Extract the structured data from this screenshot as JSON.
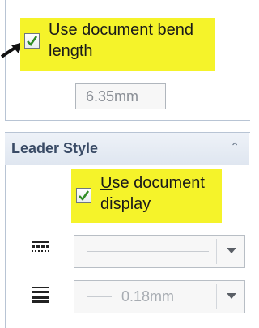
{
  "top_panel": {
    "bend_checkbox_label": "Use document bend length",
    "bend_checkbox_checked": true,
    "bend_length_value": "6.35mm"
  },
  "leader_style": {
    "title": "Leader Style",
    "display_checkbox_label_underlined": "U",
    "display_checkbox_label_rest": "se document display",
    "display_checkbox_checked": true,
    "line_style_value": "",
    "line_thickness_value": "0.18mm"
  },
  "colors": {
    "highlight": "#f5f32a",
    "header_text": "#3a4b66",
    "check_green": "#2e8b24"
  }
}
